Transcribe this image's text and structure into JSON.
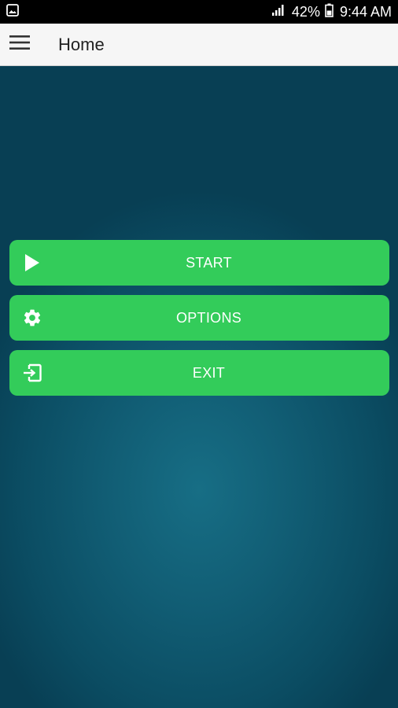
{
  "status_bar": {
    "left_icon": "image-notification-icon",
    "signal_icon": "signal-icon",
    "battery_percent": "42%",
    "battery_icon": "battery-icon",
    "time": "9:44 AM"
  },
  "app_bar": {
    "menu_icon": "hamburger-menu-icon",
    "title": "Home"
  },
  "menu": {
    "buttons": [
      {
        "label": "START",
        "icon": "play-icon"
      },
      {
        "label": "OPTIONS",
        "icon": "gear-icon"
      },
      {
        "label": "EXIT",
        "icon": "exit-icon"
      }
    ]
  },
  "colors": {
    "button_green": "#33cc5a",
    "background_teal": "#0d4a5e",
    "app_bar_bg": "#f6f6f6",
    "status_bar_bg": "#000000"
  }
}
